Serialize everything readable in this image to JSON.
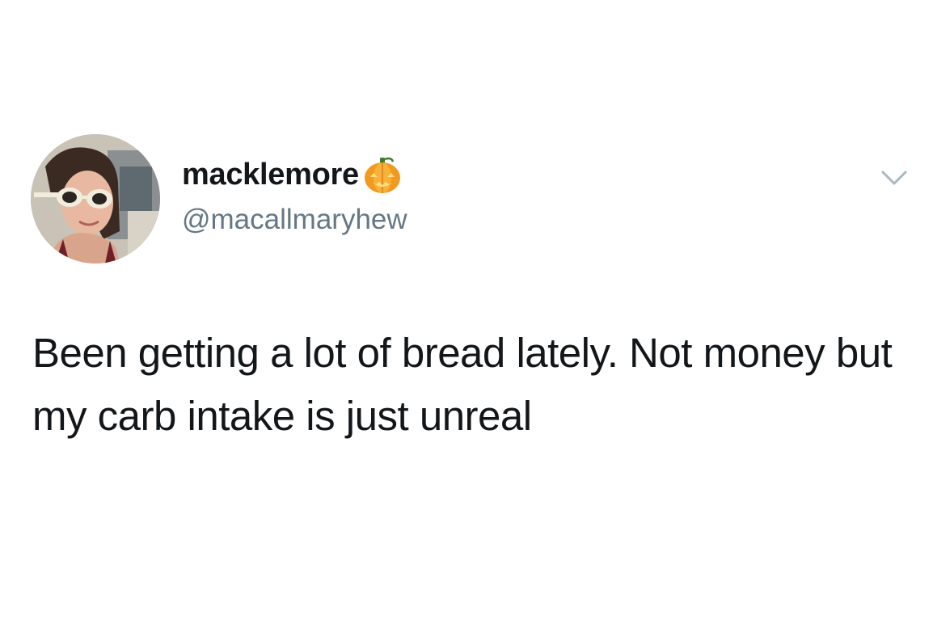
{
  "tweet": {
    "display_name": "macklemore",
    "name_emoji": "pumpkin-icon",
    "handle": "@macallmaryhew",
    "text": "Been getting a lot of bread lately. Not money but my carb intake is just unreal"
  },
  "colors": {
    "text_primary": "#14171a",
    "text_secondary": "#657786",
    "caret": "#aab8c2",
    "background": "#ffffff"
  }
}
